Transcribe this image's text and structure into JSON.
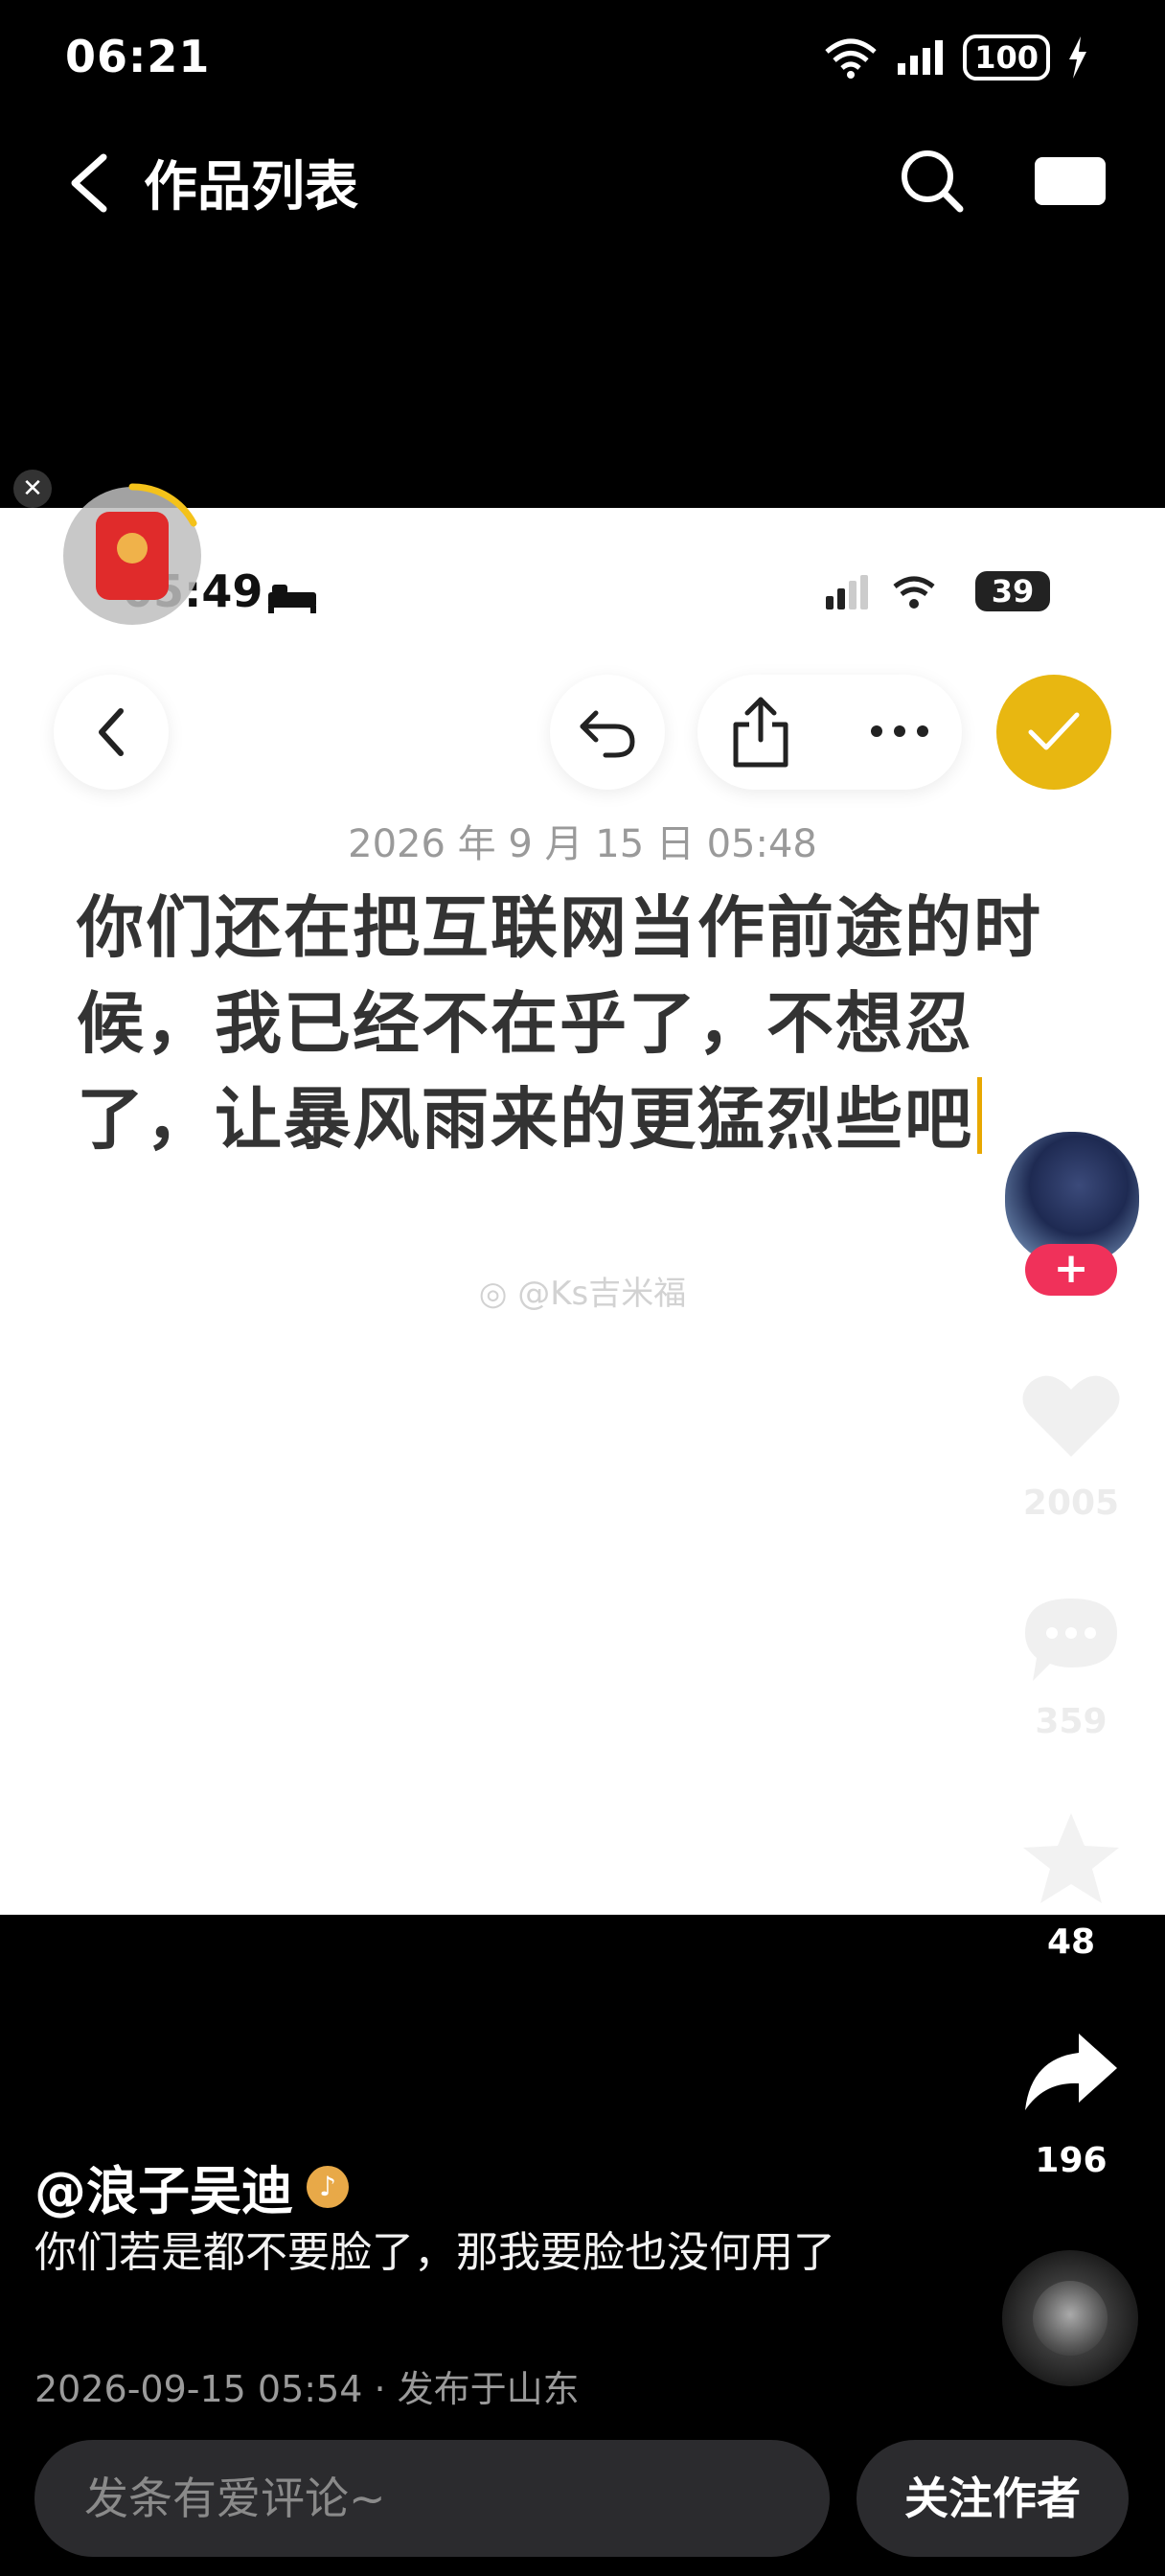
{
  "status_bar": {
    "time": "06:21",
    "battery": "100"
  },
  "header": {
    "title": "作品列表"
  },
  "screenshot": {
    "status_time": "05:49",
    "battery": "39",
    "note_date": "2026 年 9 月 15 日 05:48",
    "note_text": "你们还在把互联网当作前途的时候，我已经不在乎了，不想忍了，让暴风雨来的更猛烈些吧",
    "watermark": "@Ks吉米福"
  },
  "rail": {
    "like_count": "2005",
    "comment_count": "359",
    "favorite_count": "48",
    "share_count": "196",
    "follow_plus": "+"
  },
  "post": {
    "author": "@浪子吴迪",
    "music_badge": "♪",
    "description": "你们若是都不要脸了，那我要脸也没何用了",
    "meta": "2026-09-15 05:54 · 发布于山东"
  },
  "bottom": {
    "comment_placeholder": "发条有爱评论~",
    "follow_label": "关注作者"
  },
  "widget": {
    "close_label": "✕"
  },
  "colors": {
    "accent_yellow": "#e8b711",
    "follow_pink": "#f0315a",
    "bg": "#000000"
  }
}
